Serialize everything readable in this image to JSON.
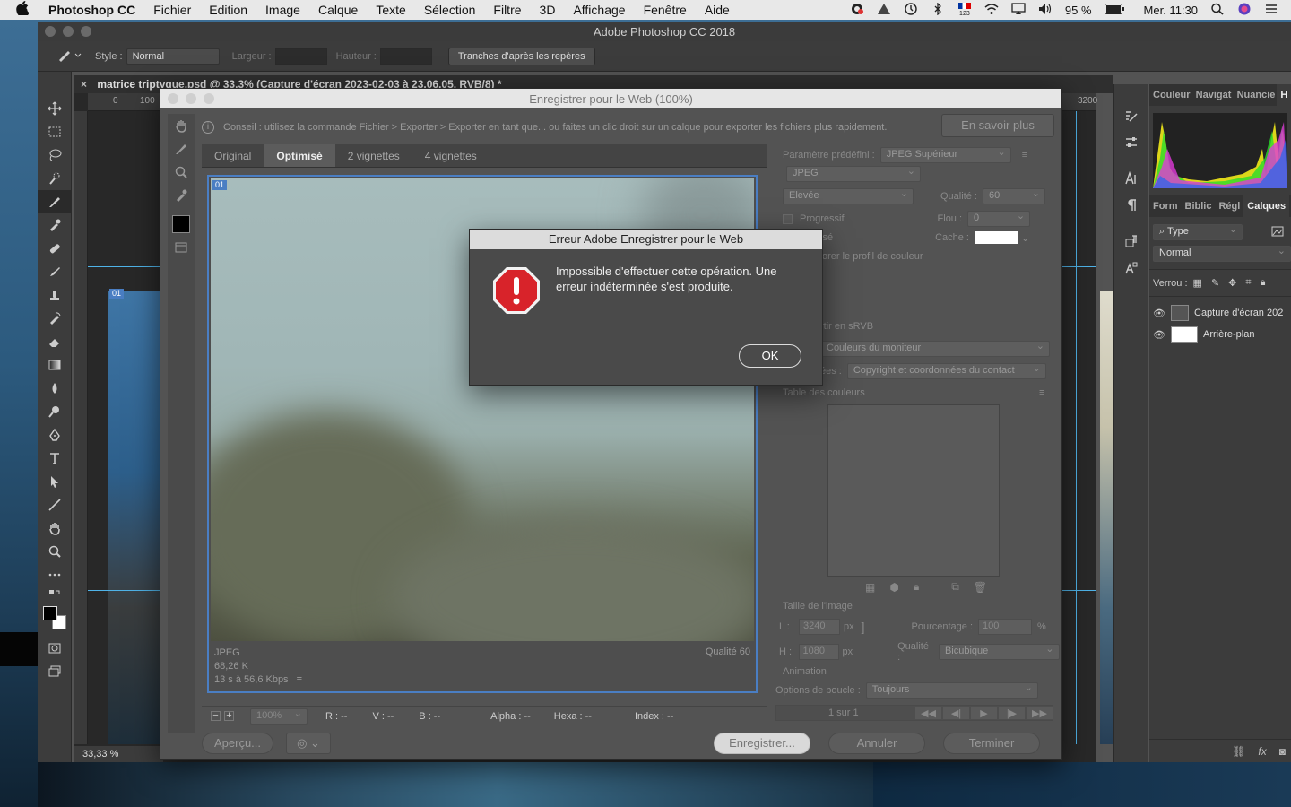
{
  "menubar": {
    "app_name": "Photoshop CC",
    "menus": [
      "Fichier",
      "Edition",
      "Image",
      "Calque",
      "Texte",
      "Sélection",
      "Filtre",
      "3D",
      "Affichage",
      "Fenêtre",
      "Aide"
    ],
    "battery": "95 %",
    "clock": "Mer. 11:30",
    "input_source": "123"
  },
  "ps": {
    "window_title": "Adobe Photoshop CC 2018",
    "options": {
      "style_label": "Style :",
      "style_value": "Normal",
      "width_label": "Largeur :",
      "height_label": "Hauteur :",
      "slices_button": "Tranches d'après les repères"
    },
    "doc_tab": "matrice triptyque.psd @ 33,3% (Capture d'écran 2023-02-03 à 23.06.05, RVB/8) *",
    "zoom": "33,33 %",
    "ruler_h": [
      "0",
      "100"
    ],
    "ruler_h_right": "3200",
    "slice_badge": "01"
  },
  "panels": {
    "tabs_top": [
      "Couleur",
      "Navigat",
      "Nuancie",
      "H"
    ],
    "tabs_layers": [
      "Form",
      "Biblic",
      "Régl",
      "Calques"
    ],
    "filter_type": "Type",
    "blend_mode": "Normal",
    "lock_label": "Verrou :",
    "layers": [
      "Capture d'écran 202",
      "Arrière-plan"
    ]
  },
  "sfw": {
    "title": "Enregistrer pour le Web (100%)",
    "tip": "Conseil : utilisez la commande Fichier > Exporter > Exporter en tant que... ou faites un clic droit sur un calque pour exporter les fichiers plus rapidement.",
    "learn_more": "En savoir plus",
    "tabs": [
      "Original",
      "Optimisé",
      "2 vignettes",
      "4 vignettes"
    ],
    "active_tab": "Optimisé",
    "slice_badge": "01",
    "preview_info": [
      "JPEG",
      "68,26 K",
      "13 s à 56,6 Kbps"
    ],
    "preview_quality": "Qualité 60",
    "status": {
      "zoom": "100%",
      "r": "R : --",
      "v": "V : --",
      "b": "B : --",
      "alpha": "Alpha : --",
      "hexa": "Hexa : --",
      "index": "Index : --"
    },
    "settings": {
      "preset_label": "Paramètre prédéfini :",
      "preset_value": "JPEG Supérieur",
      "format": "JPEG",
      "compression": "Elevée",
      "quality_label": "Qualité :",
      "quality_value": "60",
      "progressive": "Progressif",
      "blur_label": "Flou :",
      "blur_value": "0",
      "optimized_partial": "isé",
      "matte_label": "Cache :",
      "color_profile_partial": "orer le profil de couleur",
      "srgb_partial": "rtir en sRVB",
      "preview_value": "Couleurs du moniteur",
      "metadata_partial": "ées :",
      "metadata_value": "Copyright et coordonnées du contact",
      "color_table_label": "Table des couleurs",
      "image_size_label": "Taille de l'image",
      "w_label": "L :",
      "w_value": "3240",
      "h_label": "H :",
      "h_value": "1080",
      "px": "px",
      "percent_label": "Pourcentage :",
      "percent_value": "100",
      "percent_unit": "%",
      "resample_label": "Qualité :",
      "resample_value": "Bicubique",
      "animation_label": "Animation",
      "loop_label": "Options de boucle :",
      "loop_value": "Toujours",
      "frame_counter": "1 sur 1"
    },
    "buttons": {
      "preview": "Aperçu...",
      "save": "Enregistrer...",
      "cancel": "Annuler",
      "done": "Terminer"
    }
  },
  "alert": {
    "title": "Erreur Adobe Enregistrer pour le Web",
    "message": "Impossible d'effectuer cette opération. Une erreur indéterminée s'est produite.",
    "ok": "OK"
  },
  "colors": {
    "accent_blue": "#4a7ec3",
    "alert_red": "#d8232a"
  }
}
